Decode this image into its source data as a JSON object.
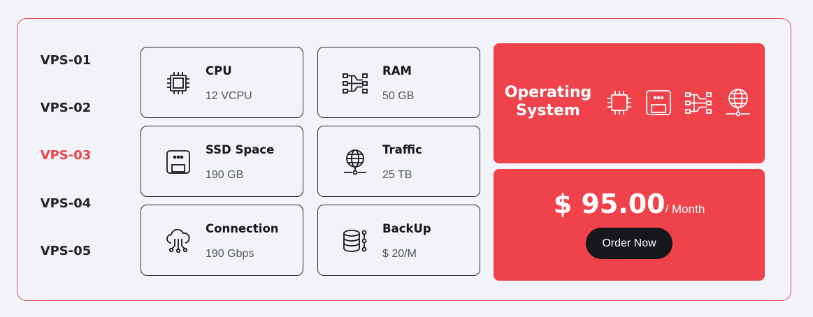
{
  "plans": [
    {
      "label": "VPS-01",
      "active": false
    },
    {
      "label": "VPS-02",
      "active": false
    },
    {
      "label": "VPS-03",
      "active": true
    },
    {
      "label": "VPS-04",
      "active": false
    },
    {
      "label": "VPS-05",
      "active": false
    }
  ],
  "specs": {
    "cpu": {
      "title": "CPU",
      "value": "12 VCPU",
      "icon": "cpu-chip-icon"
    },
    "ram": {
      "title": "RAM",
      "value": "50 GB",
      "icon": "ram-memory-icon"
    },
    "ssd": {
      "title": "SSD Space",
      "value": "190 GB",
      "icon": "ssd-drive-icon"
    },
    "traffic": {
      "title": "Traffic",
      "value": "25 TB",
      "icon": "globe-network-icon"
    },
    "connection": {
      "title": "Connection",
      "value": "190 Gbps",
      "icon": "cloud-network-icon"
    },
    "backup": {
      "title": "BackUp",
      "value": "$ 20/M",
      "icon": "database-backup-icon"
    }
  },
  "os_panel": {
    "title_line1": "Operating",
    "title_line2": "System",
    "icons": [
      "cpu-chip-icon",
      "ssd-drive-icon",
      "ram-memory-icon",
      "globe-network-icon"
    ]
  },
  "pricing": {
    "amount": "$ 95.00",
    "period": "/ Month",
    "order_label": "Order Now"
  },
  "colors": {
    "accent": "#f0424b",
    "dark_button": "#17181d",
    "background": "#f1f3f8"
  }
}
